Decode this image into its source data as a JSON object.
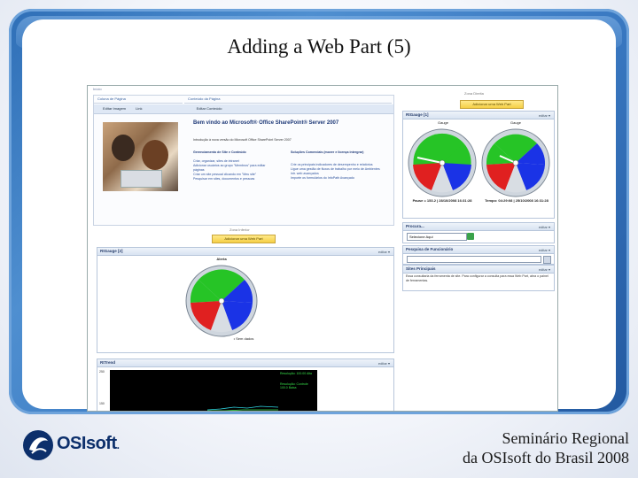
{
  "slide": {
    "title": "Adding a Web Part (5)",
    "footer_line1": "Seminário Regional",
    "footer_line2": "da OSIsoft do Brasil 2008",
    "logo_text": "OSIsoft",
    "logo_suffix": "."
  },
  "screen": {
    "breadcrumb": "Início",
    "left_zone_label": "Coluna de Página",
    "mid_zone_label": "Conteúdo da Página",
    "right_zone_label": "Zona Direita",
    "toolbar": {
      "edit_label": "Editar Imagem",
      "link_label": "Link",
      "edit_content_label": "Editar Conteúdo"
    },
    "welcome": {
      "heading": "Bem vindo ao Microsoft® Office SharePoint® Server 2007",
      "intro": "Introdução à nova versão do Microsoft Office SharePoint Server 2007",
      "col1_title": "Gerenciamento de Site e Conteúdo",
      "col1_items": [
        "Criar, organizar, sites de intranet",
        "Adicionar usuários ao grupo \"Membros\" para editar páginas",
        "Criar um site pessoal clicando em \"Meu site\"",
        "Pesquisar em sites, documentos e pessoas"
      ],
      "col2_title": "Soluções Comerciais (mover e licença intergrar)",
      "col2_items": [
        "Crie os principais indicadores de desempenho e relatórios",
        "Ligue uma gestão de fluxos de trabalho por meio de Ambientes intr. web avançados",
        "Importe os formulários do InfoPath Avançado"
      ]
    },
    "zone_bottom_label": "Zona Inferior",
    "add_web_part_label": "Adicionar uma Web Part",
    "wp_right_gauges": {
      "title": "RtGauge [1]",
      "menu": "editar ▾",
      "gauge1_label": "Gauge",
      "gauge2_label": "Gauge",
      "gauge1_cap": "Pause = 153.2 | 28/10/2008 16:31:28",
      "gauge2_cap": "Tempo: 04:29:08 | 25/10/2008 16:31:28"
    },
    "wp_center_gauge": {
      "title": "RtGauge [2]",
      "menu": "editar ▾",
      "label": "Alerta",
      "cap": "• Sem dados"
    },
    "wp_trend": {
      "title": "RtTrend",
      "menu": "editar ▾",
      "legend1": "Resolução: 100.00 Alta",
      "legend2": "Resolução: Controle 100.0 Baixa",
      "y_top": "250",
      "y_bot": "150"
    },
    "wp_search": {
      "title": "Procura...",
      "menu": "editar ▾",
      "select_value": "Selecione Aqui"
    },
    "wp_people": {
      "title": "Pesquisa de Funcionário",
      "menu": "editar ▾"
    },
    "wp_sites": {
      "title": "Sites Principais",
      "menu": "editar ▾",
      "body": "Essa consultaria da ferramenta de site. Para configurar a consulta para essa Web Part, abra o painel de ferramentas."
    },
    "colors": {
      "gauge_red": "#e02020",
      "gauge_green": "#26c426",
      "gauge_blue": "#1a33e6",
      "accent": "#2359a0"
    }
  }
}
